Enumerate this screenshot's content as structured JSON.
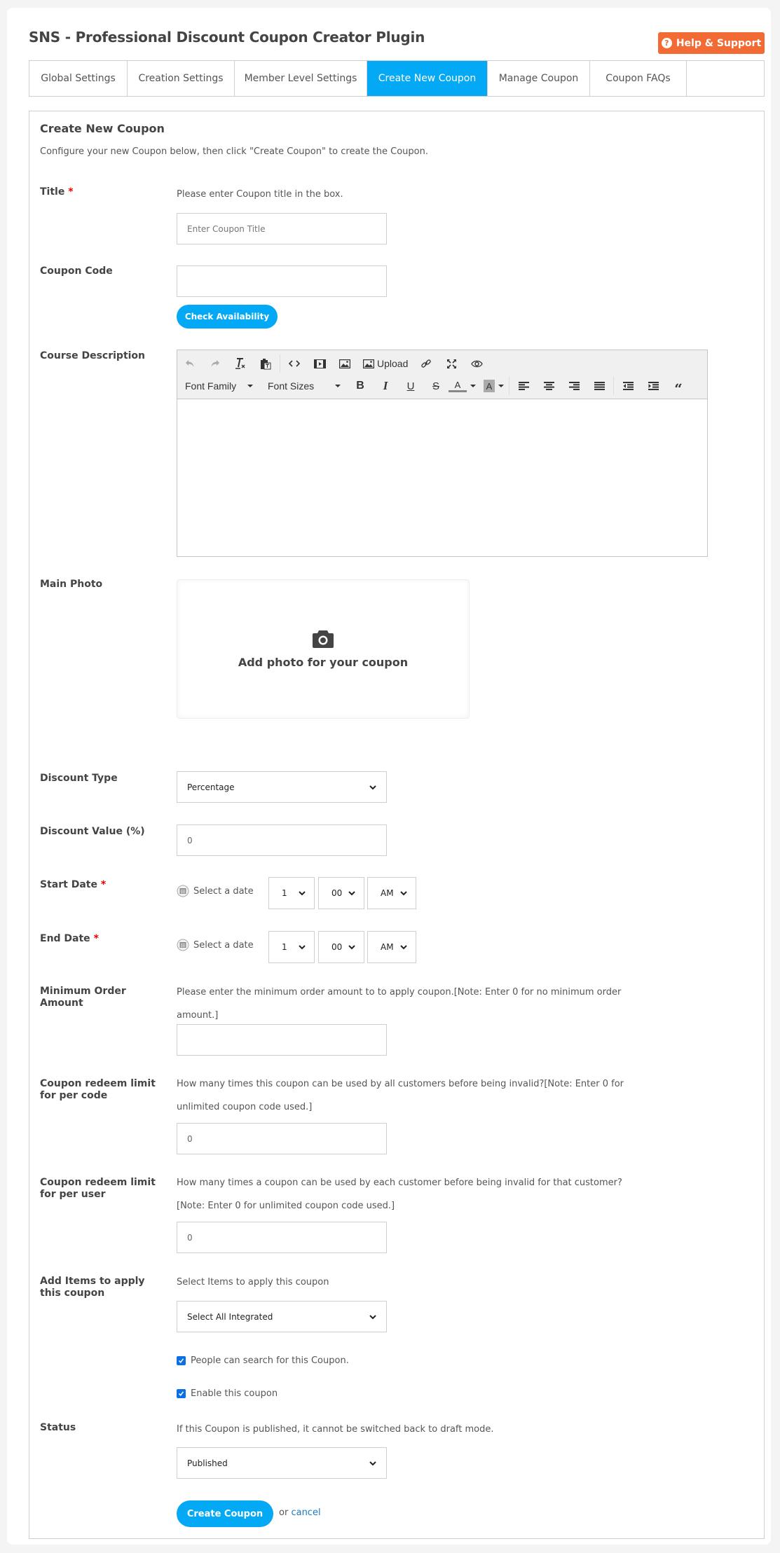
{
  "header": {
    "title": "SNS - Professional Discount Coupon Creator Plugin",
    "help_button": "Help & Support",
    "help_color": "#f26b35"
  },
  "tabs": [
    {
      "label": "Global Settings",
      "active": false
    },
    {
      "label": "Creation Settings",
      "active": false
    },
    {
      "label": "Member Level Settings",
      "active": false
    },
    {
      "label": "Create New Coupon",
      "active": true
    },
    {
      "label": "Manage Coupon",
      "active": false
    },
    {
      "label": "Coupon FAQs",
      "active": false
    }
  ],
  "accent_color": "#03a9f4",
  "form": {
    "heading": "Create New Coupon",
    "description": "Configure your new Coupon below, then click \"Create Coupon\" to create the Coupon.",
    "title": {
      "label": "Title",
      "required_mark": "*",
      "hint": "Please enter Coupon title in the box.",
      "placeholder": "Enter Coupon Title",
      "value": ""
    },
    "coupon_code": {
      "label": "Coupon Code",
      "value": "",
      "check_button": "Check Availability"
    },
    "description_editor": {
      "label": "Course Description",
      "toolbar_row1": [
        "undo-icon",
        "redo-icon",
        "clear-formatting-icon",
        "paste-text-icon",
        "code-icon",
        "media-icon",
        "image-icon",
        "upload-image-icon",
        "link-icon",
        "fullscreen-icon",
        "preview-icon"
      ],
      "upload_label": "Upload",
      "font_family_label": "Font Family",
      "font_sizes_label": "Font Sizes",
      "toolbar_row2": [
        "bold-icon",
        "italic-icon",
        "underline-icon",
        "strikethrough-icon",
        "text-color-icon",
        "background-color-icon",
        "align-left-icon",
        "align-center-icon",
        "align-right-icon",
        "align-justify-icon",
        "outdent-icon",
        "indent-icon",
        "blockquote-icon"
      ],
      "content": ""
    },
    "main_photo": {
      "label": "Main Photo",
      "prompt": "Add photo for your coupon"
    },
    "discount_type": {
      "label": "Discount Type",
      "selected": "Percentage"
    },
    "discount_value": {
      "label": "Discount Value (%)",
      "value": "0"
    },
    "start_date": {
      "label": "Start Date",
      "required_mark": "*",
      "date_placeholder": "Select a date",
      "hour": "1",
      "minute": "00",
      "meridiem": "AM"
    },
    "end_date": {
      "label": "End Date",
      "required_mark": "*",
      "date_placeholder": "Select a date",
      "hour": "1",
      "minute": "00",
      "meridiem": "AM"
    },
    "min_order": {
      "label": "Minimum Order Amount",
      "hint": "Please enter the minimum order amount to to apply coupon.[Note: Enter 0 for no minimum order amount.]",
      "value": ""
    },
    "limit_per_code": {
      "label": "Coupon redeem limit for per code",
      "hint": "How many times this coupon can be used by all customers before being invalid?[Note: Enter 0 for unlimited coupon code used.]",
      "value": "0"
    },
    "limit_per_user": {
      "label": "Coupon redeem limit for per user",
      "hint": "How many times a coupon can be used by each customer before being invalid for that customer?[Note: Enter 0 for unlimited coupon code used.]",
      "value": "0"
    },
    "items": {
      "label": "Add Items to apply this coupon",
      "hint": "Select Items to apply this coupon",
      "selected": "Select All Integrated"
    },
    "searchable": {
      "label": "People can search for this Coupon.",
      "checked": true
    },
    "enabled": {
      "label": "Enable this coupon",
      "checked": true
    },
    "status": {
      "label": "Status",
      "hint": "If this Coupon is published, it cannot be switched back to draft mode.",
      "selected": "Published"
    },
    "submit_button": "Create Coupon",
    "or_text": "or",
    "cancel_link": "cancel"
  }
}
